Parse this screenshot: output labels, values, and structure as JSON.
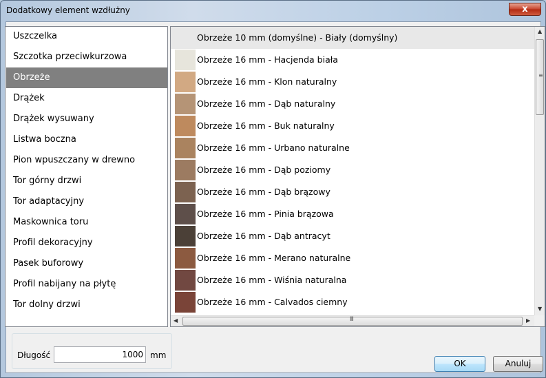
{
  "window": {
    "title": "Dodatkowy element wzdłużny",
    "close_symbol": "x"
  },
  "categories": [
    {
      "label": "Uszczelka"
    },
    {
      "label": "Szczotka przeciwkurzowa"
    },
    {
      "label": "Obrzeże",
      "selected": true
    },
    {
      "label": "Drążek"
    },
    {
      "label": "Drążek wysuwany"
    },
    {
      "label": "Listwa boczna"
    },
    {
      "label": "Pion wpuszczany w drewno"
    },
    {
      "label": "Tor górny drzwi"
    },
    {
      "label": "Tor adaptacyjny"
    },
    {
      "label": "Maskownica toru"
    },
    {
      "label": "Profil dekoracyjny"
    },
    {
      "label": "Pasek buforowy"
    },
    {
      "label": "Profil nabijany na płytę"
    },
    {
      "label": "Tor dolny drzwi"
    }
  ],
  "variants": [
    {
      "label": "Obrzeże 10 mm (domyślne) - Biały (domyślny)",
      "color": null
    },
    {
      "label": "Obrzeże 16 mm - Hacjenda biała",
      "color": "#e7e5dc"
    },
    {
      "label": "Obrzeże 16 mm - Klon naturalny",
      "color": "#d2a983"
    },
    {
      "label": "Obrzeże 16 mm - Dąb naturalny",
      "color": "#b59476"
    },
    {
      "label": "Obrzeże 16 mm - Buk naturalny",
      "color": "#be8a5e"
    },
    {
      "label": "Obrzeże 16 mm - Urbano naturalne",
      "color": "#aa835f"
    },
    {
      "label": "Obrzeże 16 mm - Dąb poziomy",
      "color": "#9c7b61"
    },
    {
      "label": "Obrzeże 16 mm - Dąb brązowy",
      "color": "#7c6250"
    },
    {
      "label": "Obrzeże 16 mm - Pinia brązowa",
      "color": "#5e4f4a"
    },
    {
      "label": "Obrzeże 16 mm - Dąb antracyt",
      "color": "#4b4037"
    },
    {
      "label": "Obrzeże 16 mm - Merano naturalne",
      "color": "#8c5a40"
    },
    {
      "label": "Obrzeże 16 mm - Wiśnia naturalna",
      "color": "#714841"
    },
    {
      "label": "Obrzeże 16 mm - Calvados ciemny",
      "color": "#7a4438"
    }
  ],
  "scroll": {
    "up": "▲",
    "down": "▼",
    "left": "◀",
    "right": "▶",
    "grip_v": "≡",
    "grip_h": "III"
  },
  "length": {
    "label": "Długość",
    "value": "1000",
    "unit": "mm"
  },
  "buttons": {
    "ok": "OK",
    "cancel": "Anuluj"
  }
}
